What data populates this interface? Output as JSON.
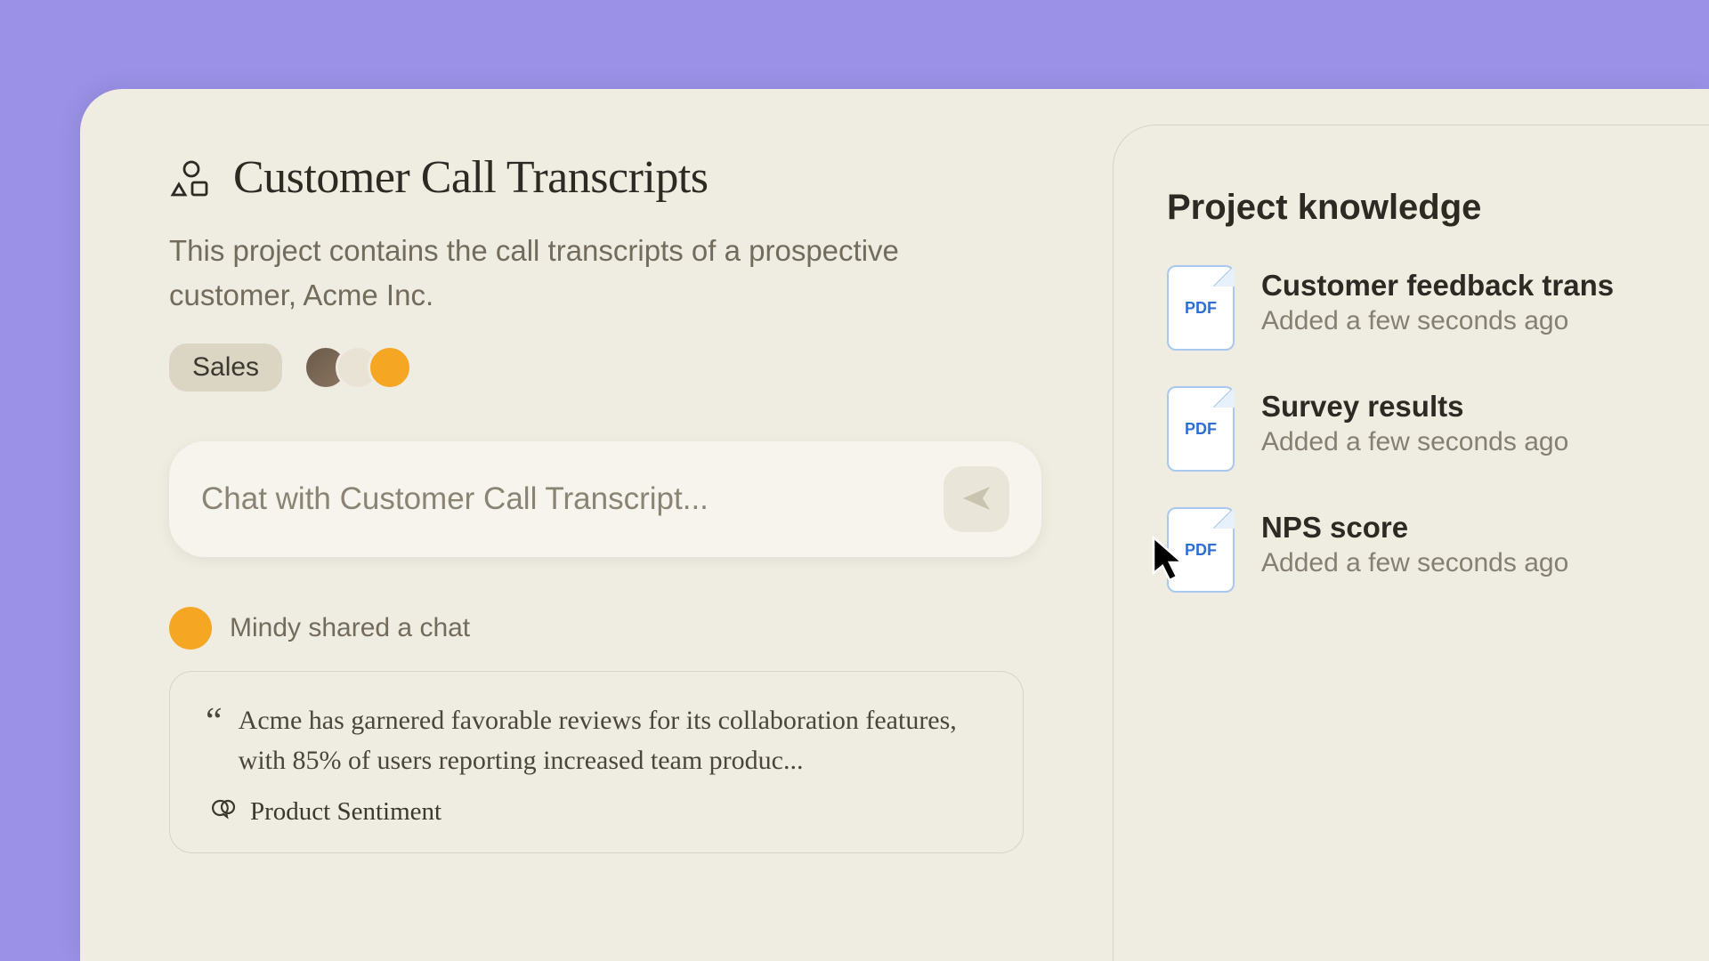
{
  "project": {
    "title": "Customer Call Transcripts",
    "description": "This project contains the call transcripts of a prospective customer, Acme Inc.",
    "tag": "Sales"
  },
  "chat": {
    "placeholder": "Chat with Customer Call Transcript..."
  },
  "shared": {
    "author": "Mindy shared a chat",
    "quote": "Acme has garnered favorable reviews for its collaboration features, with 85% of users reporting increased team produc...",
    "sentiment_label": "Product Sentiment"
  },
  "knowledge": {
    "heading": "Project knowledge",
    "pdf_label": "PDF",
    "items": [
      {
        "title": "Customer feedback trans",
        "meta": "Added a few seconds ago"
      },
      {
        "title": "Survey results",
        "meta": "Added a few seconds ago"
      },
      {
        "title": "NPS score",
        "meta": "Added a few seconds ago"
      }
    ]
  }
}
